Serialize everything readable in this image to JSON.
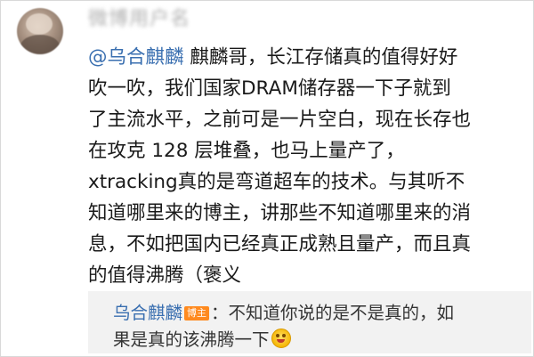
{
  "commenter": {
    "username_blurred": "微博用户名"
  },
  "comment": {
    "mention": "@乌合麒麟",
    "lines": [
      " 麒麟哥，长江存储真的值得好好",
      "吹一吹，我们国家DRAM储存器一下子就到",
      "了主流水平，之前可是一片空白，现在长存也",
      "在攻克 128 层堆叠，也马上量产了，",
      "xtracking真的是弯道超车的技术。与其听不",
      "知道哪里来的博主，讲那些不知道哪里来的消",
      "息，不如把国内已经真正成熟且量产，而且真",
      "的值得沸腾（褒义"
    ]
  },
  "reply": {
    "author": "乌合麒麟",
    "badge": "博主",
    "line1": "：不知道你说的是不是真的，如",
    "line2": "果是真的该沸腾一下",
    "emoji": "grinning-face-icon"
  }
}
